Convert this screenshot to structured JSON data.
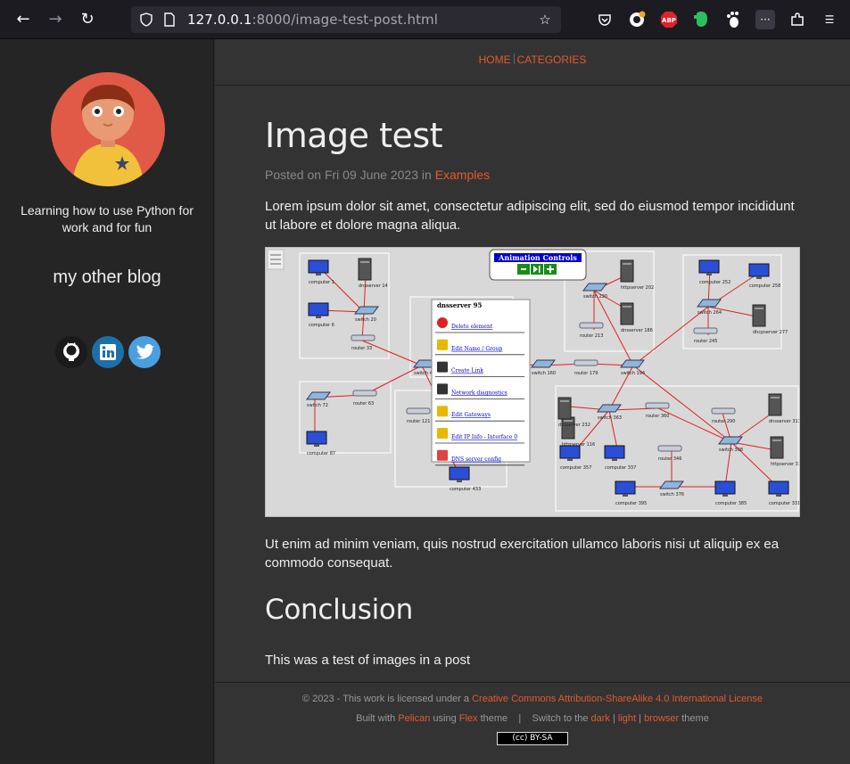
{
  "browser": {
    "url_host": "127.0.0.1",
    "url_rest": ":8000/image-test-post.html"
  },
  "sidebar": {
    "tagline": "Learning how to use Python for work and for fun",
    "other_blog": "my other blog",
    "social": [
      {
        "name": "github",
        "color": "#1a1a1a"
      },
      {
        "name": "linkedin",
        "color": "#1e6fa8"
      },
      {
        "name": "twitter",
        "color": "#4a9fe0"
      }
    ]
  },
  "nav": {
    "home": "Home",
    "categories": "Categories"
  },
  "post": {
    "title": "Image test",
    "meta_prefix": "Posted on Fri 09 June 2023 in ",
    "category": "Examples",
    "para1": "Lorem ipsum dolor sit amet, consectetur adipiscing elit, sed do eiusmod tempor incididunt ut labore et dolore magna aliqua.",
    "para2": "Ut enim ad minim veniam, quis nostrud exercitation ullamco laboris nisi ut aliquip ex ea commodo consequat.",
    "heading2": "Conclusion",
    "para3": "This was a test of images in a post"
  },
  "figure": {
    "animation_title": "Animation Controls",
    "menu_title": "dnsserver 95",
    "menu_items": [
      "Delete element",
      "Edit Name / Group",
      "Create Link",
      "Network diagnostics",
      "Edit Gateways",
      "Edit IP Info - Interface 0",
      "DNS server config"
    ],
    "node_labels": [
      "computer 1",
      "dnsserver 14",
      "computer 6",
      "switch 20",
      "router 33",
      "switch 48",
      "switch 72",
      "router 63",
      "computer 87",
      "router 179",
      "switch 160",
      "switch 194",
      "switch 220",
      "router 213",
      "httpserver 202",
      "dnsserver 186",
      "computer 252",
      "computer 258",
      "switch 264",
      "router 245",
      "dhcpserver 277",
      "router 121",
      "switch 127",
      "computer 433",
      "httpserver 116",
      "dnsserver 232",
      "switch 363",
      "router 360",
      "computer 357",
      "computer 337",
      "router 346",
      "switch 376",
      "computer 395",
      "computer 385",
      "router 290",
      "switch 308",
      "dnsserver 313",
      "httpserver 319",
      "computer 331"
    ]
  },
  "footer": {
    "line1_prefix": "© 2023 - This work is licensed under a ",
    "license": "Creative Commons Attribution-ShareAlike 4.0 International License",
    "built_prefix": "Built with ",
    "pelican": "Pelican",
    "using": " using ",
    "flex": "Flex",
    "theme_switch": " theme    |    Switch to the ",
    "dark": "dark",
    "light": "light",
    "browser": "browser",
    "theme_suffix": " theme",
    "cc_badge": "(cc) BY-SA"
  }
}
